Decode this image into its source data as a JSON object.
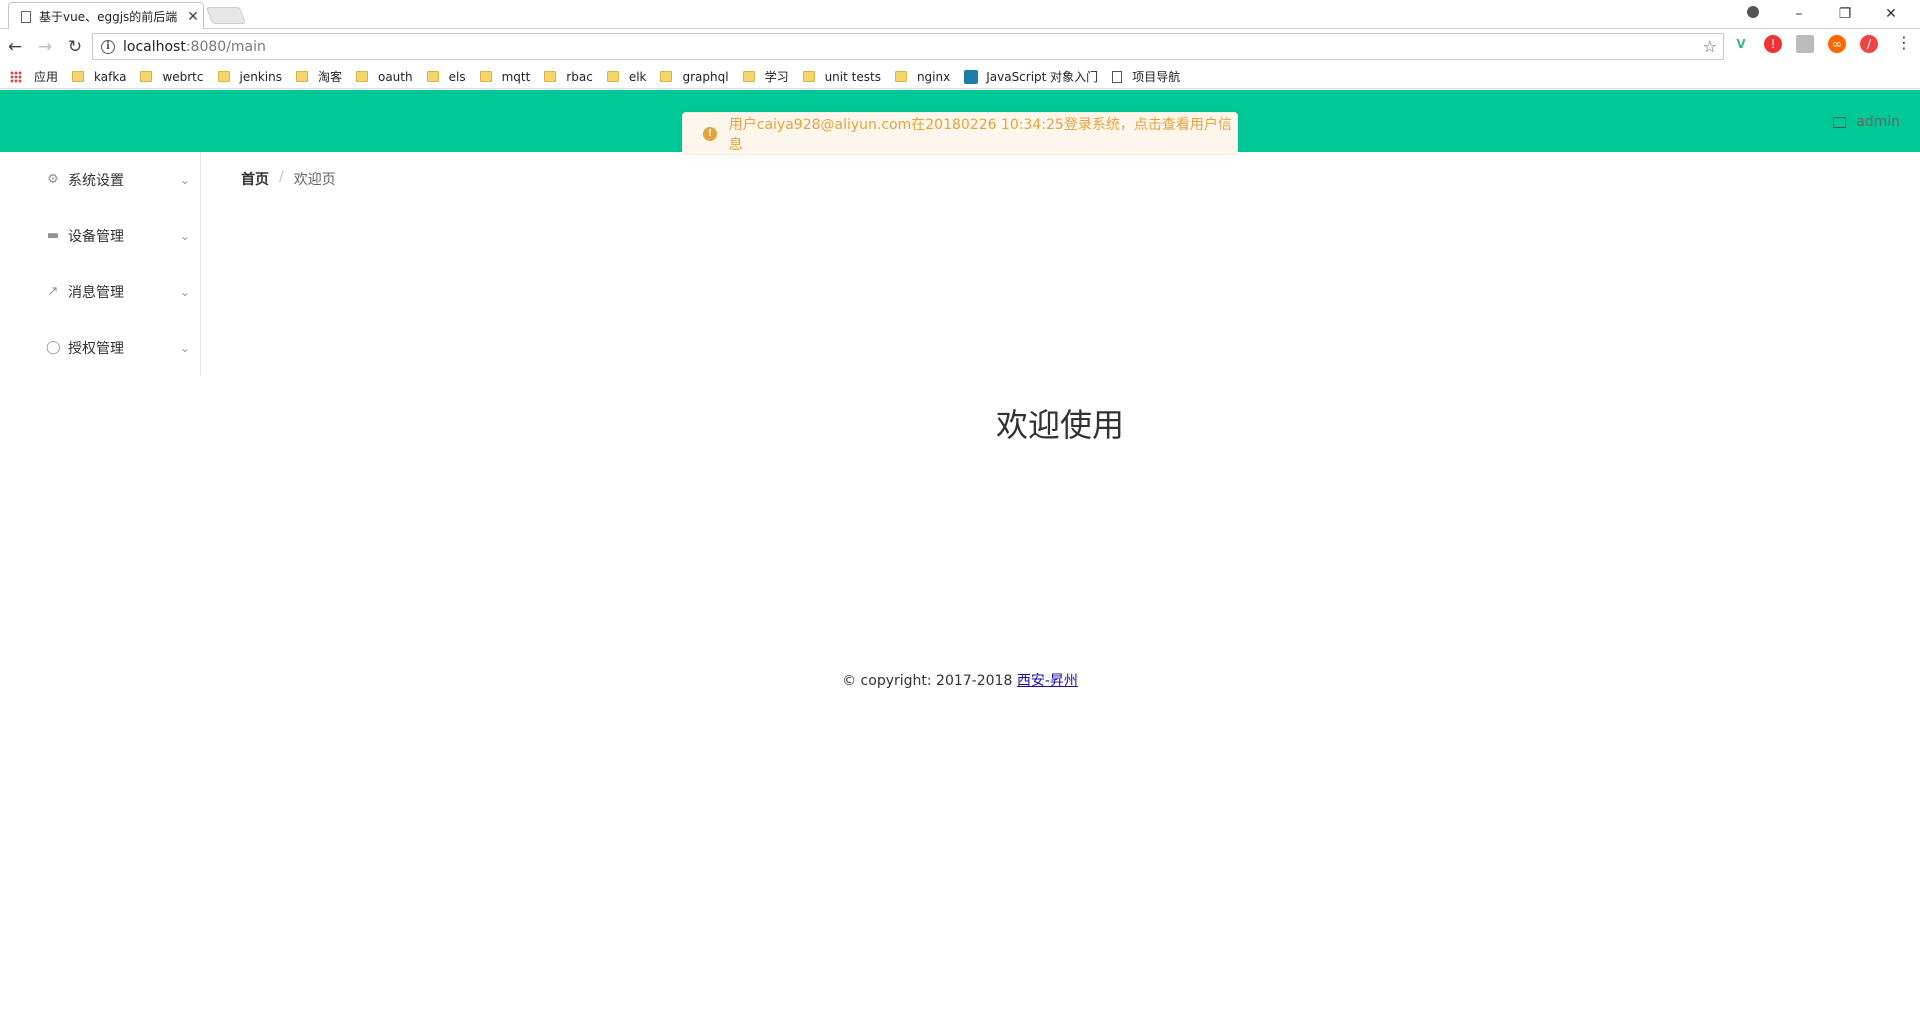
{
  "browser": {
    "tab_title": "基于vue、eggjs的前后端",
    "tab_close": "✕",
    "url_host": "localhost",
    "url_rest": ":8080/main",
    "bookmarks": [
      {
        "label": "应用",
        "icon": "apps-icon"
      },
      {
        "label": "kafka",
        "icon": "folder-icon"
      },
      {
        "label": "webrtc",
        "icon": "folder-icon"
      },
      {
        "label": "jenkins",
        "icon": "folder-icon"
      },
      {
        "label": "淘客",
        "icon": "folder-icon"
      },
      {
        "label": "oauth",
        "icon": "folder-icon"
      },
      {
        "label": "els",
        "icon": "folder-icon"
      },
      {
        "label": "mqtt",
        "icon": "folder-icon"
      },
      {
        "label": "rbac",
        "icon": "folder-icon"
      },
      {
        "label": "elk",
        "icon": "folder-icon"
      },
      {
        "label": "graphql",
        "icon": "folder-icon"
      },
      {
        "label": "学习",
        "icon": "folder-icon"
      },
      {
        "label": "unit tests",
        "icon": "folder-icon"
      },
      {
        "label": "nginx",
        "icon": "folder-icon"
      },
      {
        "label": "JavaScript 对象入门",
        "icon": "site-icon"
      },
      {
        "label": "项目导航",
        "icon": "page-icon"
      }
    ]
  },
  "header": {
    "user": "admin"
  },
  "notification": {
    "message": "用户caiya928@aliyun.com在20180226 10:34:25登录系统，点击查看用户信息"
  },
  "sidebar": {
    "items": [
      {
        "label": "系统设置",
        "icon": "gear-icon"
      },
      {
        "label": "设备管理",
        "icon": "device-icon"
      },
      {
        "label": "消息管理",
        "icon": "chart-icon"
      },
      {
        "label": "授权管理",
        "icon": "globe-icon"
      }
    ]
  },
  "breadcrumb": {
    "home": "首页",
    "separator": "/",
    "current": "欢迎页"
  },
  "main": {
    "welcome": "欢迎使用"
  },
  "footer": {
    "copyright": "© copyright: 2017-2018 ",
    "link": "西安-昇州"
  },
  "colors": {
    "header_bg": "#00c896",
    "notice_text": "#e6a23c"
  }
}
